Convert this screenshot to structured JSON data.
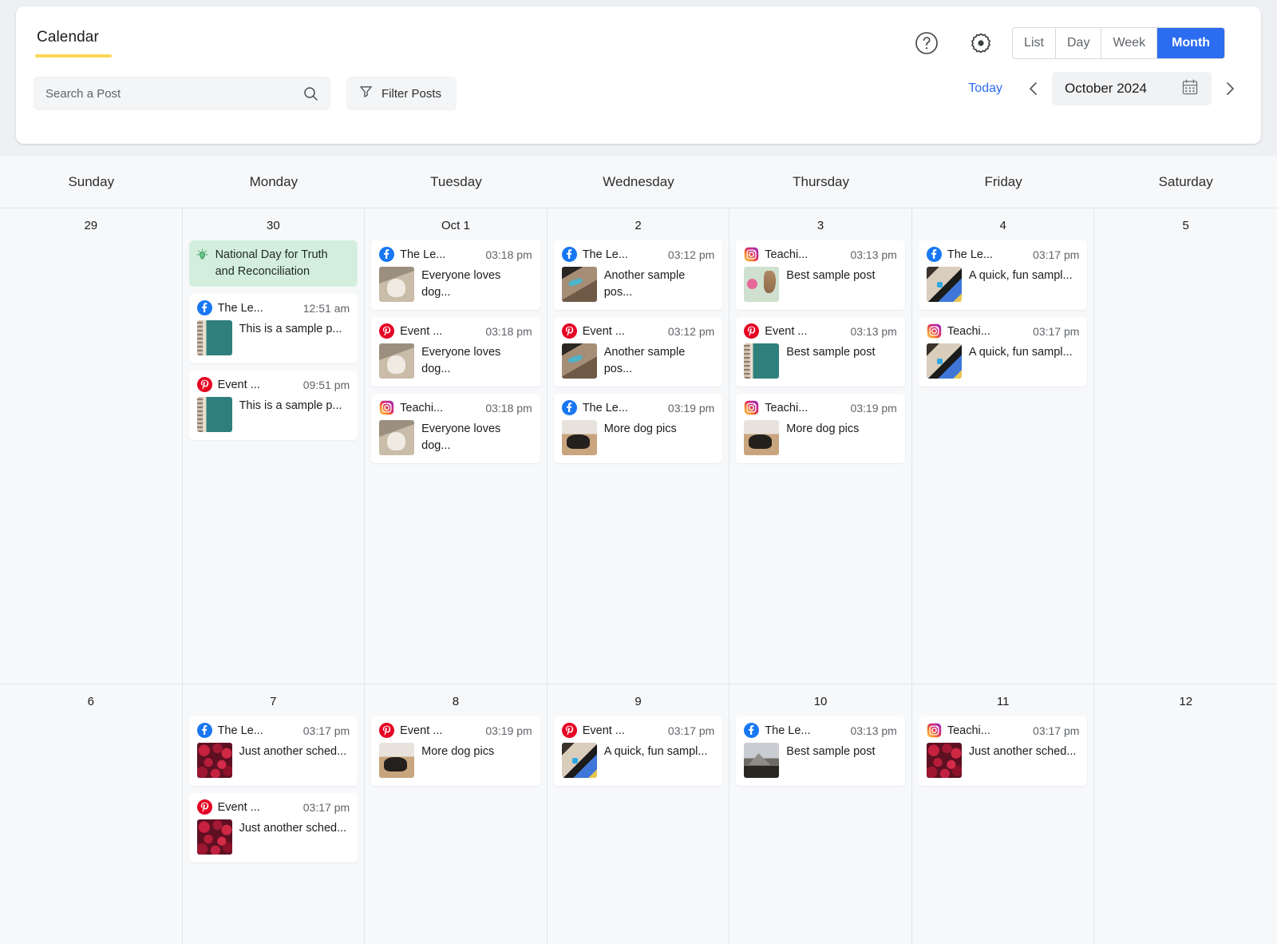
{
  "header": {
    "tab_label": "Calendar",
    "search": {
      "placeholder": "Search a Post",
      "value": ""
    },
    "filter_label": "Filter Posts",
    "help_icon": "help-circle-icon",
    "settings_icon": "gear-icon",
    "views": [
      {
        "label": "List",
        "active": false
      },
      {
        "label": "Day",
        "active": false
      },
      {
        "label": "Week",
        "active": false
      },
      {
        "label": "Month",
        "active": true
      }
    ],
    "today_label": "Today",
    "prev_icon": "chevron-left-icon",
    "next_icon": "chevron-right-icon",
    "current_period": "October 2024",
    "calendar_icon": "calendar-icon",
    "accent_blue": "#2b6cf0",
    "accent_yellow": "#fdd757"
  },
  "weekdays": [
    "Sunday",
    "Monday",
    "Tuesday",
    "Wednesday",
    "Thursday",
    "Friday",
    "Saturday"
  ],
  "weeks": [
    {
      "days": [
        {
          "num": "29",
          "holiday": null,
          "posts": []
        },
        {
          "num": "30",
          "holiday": {
            "icon": "lightbulb-icon",
            "text": "National Day for Truth and Reconciliation",
            "bg": "#d3eedd"
          },
          "posts": [
            {
              "network": "facebook",
              "account": "The Le...",
              "time": "12:51 am",
              "text": "This is a sample p...",
              "thumb": "beach"
            },
            {
              "network": "pinterest",
              "account": "Event ...",
              "time": "09:51 pm",
              "text": "This is a sample p...",
              "thumb": "beach"
            }
          ]
        },
        {
          "num": "Oct 1",
          "holiday": null,
          "posts": [
            {
              "network": "facebook",
              "account": "The Le...",
              "time": "03:18 pm",
              "text": "Everyone loves dog...",
              "thumb": "dog-cow"
            },
            {
              "network": "pinterest",
              "account": "Event ...",
              "time": "03:18 pm",
              "text": "Everyone loves dog...",
              "thumb": "dog-cow"
            },
            {
              "network": "instagram",
              "account": "Teachi...",
              "time": "03:18 pm",
              "text": "Everyone loves dog...",
              "thumb": "dog-cow"
            }
          ]
        },
        {
          "num": "2",
          "holiday": null,
          "posts": [
            {
              "network": "facebook",
              "account": "The Le...",
              "time": "03:12 pm",
              "text": "Another sample pos...",
              "thumb": "rocks"
            },
            {
              "network": "pinterest",
              "account": "Event ...",
              "time": "03:12 pm",
              "text": "Another sample pos...",
              "thumb": "rocks"
            },
            {
              "network": "facebook",
              "account": "The Le...",
              "time": "03:19 pm",
              "text": "More dog pics",
              "thumb": "puppy"
            }
          ]
        },
        {
          "num": "3",
          "holiday": null,
          "posts": [
            {
              "network": "instagram",
              "account": "Teachi...",
              "time": "03:13 pm",
              "text": "Best sample post",
              "thumb": "flowers"
            },
            {
              "network": "pinterest",
              "account": "Event ...",
              "time": "03:13 pm",
              "text": "Best sample post",
              "thumb": "beach"
            },
            {
              "network": "instagram",
              "account": "Teachi...",
              "time": "03:19 pm",
              "text": "More dog pics",
              "thumb": "puppy"
            }
          ]
        },
        {
          "num": "4",
          "holiday": null,
          "posts": [
            {
              "network": "facebook",
              "account": "The Le...",
              "time": "03:17 pm",
              "text": "A quick, fun sampl...",
              "thumb": "phone"
            },
            {
              "network": "instagram",
              "account": "Teachi...",
              "time": "03:17 pm",
              "text": "A quick, fun sampl...",
              "thumb": "phone"
            }
          ]
        },
        {
          "num": "5",
          "holiday": null,
          "posts": []
        }
      ]
    },
    {
      "days": [
        {
          "num": "6",
          "holiday": null,
          "posts": []
        },
        {
          "num": "7",
          "holiday": null,
          "posts": [
            {
              "network": "facebook",
              "account": "The Le...",
              "time": "03:17 pm",
              "text": "Just another sched...",
              "thumb": "berries"
            },
            {
              "network": "pinterest",
              "account": "Event ...",
              "time": "03:17 pm",
              "text": "Just another sched...",
              "thumb": "berries"
            }
          ]
        },
        {
          "num": "8",
          "holiday": null,
          "posts": [
            {
              "network": "pinterest",
              "account": "Event ...",
              "time": "03:19 pm",
              "text": "More dog pics",
              "thumb": "puppy"
            }
          ]
        },
        {
          "num": "9",
          "holiday": null,
          "posts": [
            {
              "network": "pinterest",
              "account": "Event ...",
              "time": "03:17 pm",
              "text": "A quick, fun sampl...",
              "thumb": "phone"
            }
          ]
        },
        {
          "num": "10",
          "holiday": null,
          "posts": [
            {
              "network": "facebook",
              "account": "The Le...",
              "time": "03:13 pm",
              "text": "Best sample post",
              "thumb": "mountain"
            }
          ]
        },
        {
          "num": "11",
          "holiday": null,
          "posts": [
            {
              "network": "instagram",
              "account": "Teachi...",
              "time": "03:17 pm",
              "text": "Just another sched...",
              "thumb": "berries"
            }
          ]
        },
        {
          "num": "12",
          "holiday": null,
          "posts": []
        }
      ]
    }
  ]
}
